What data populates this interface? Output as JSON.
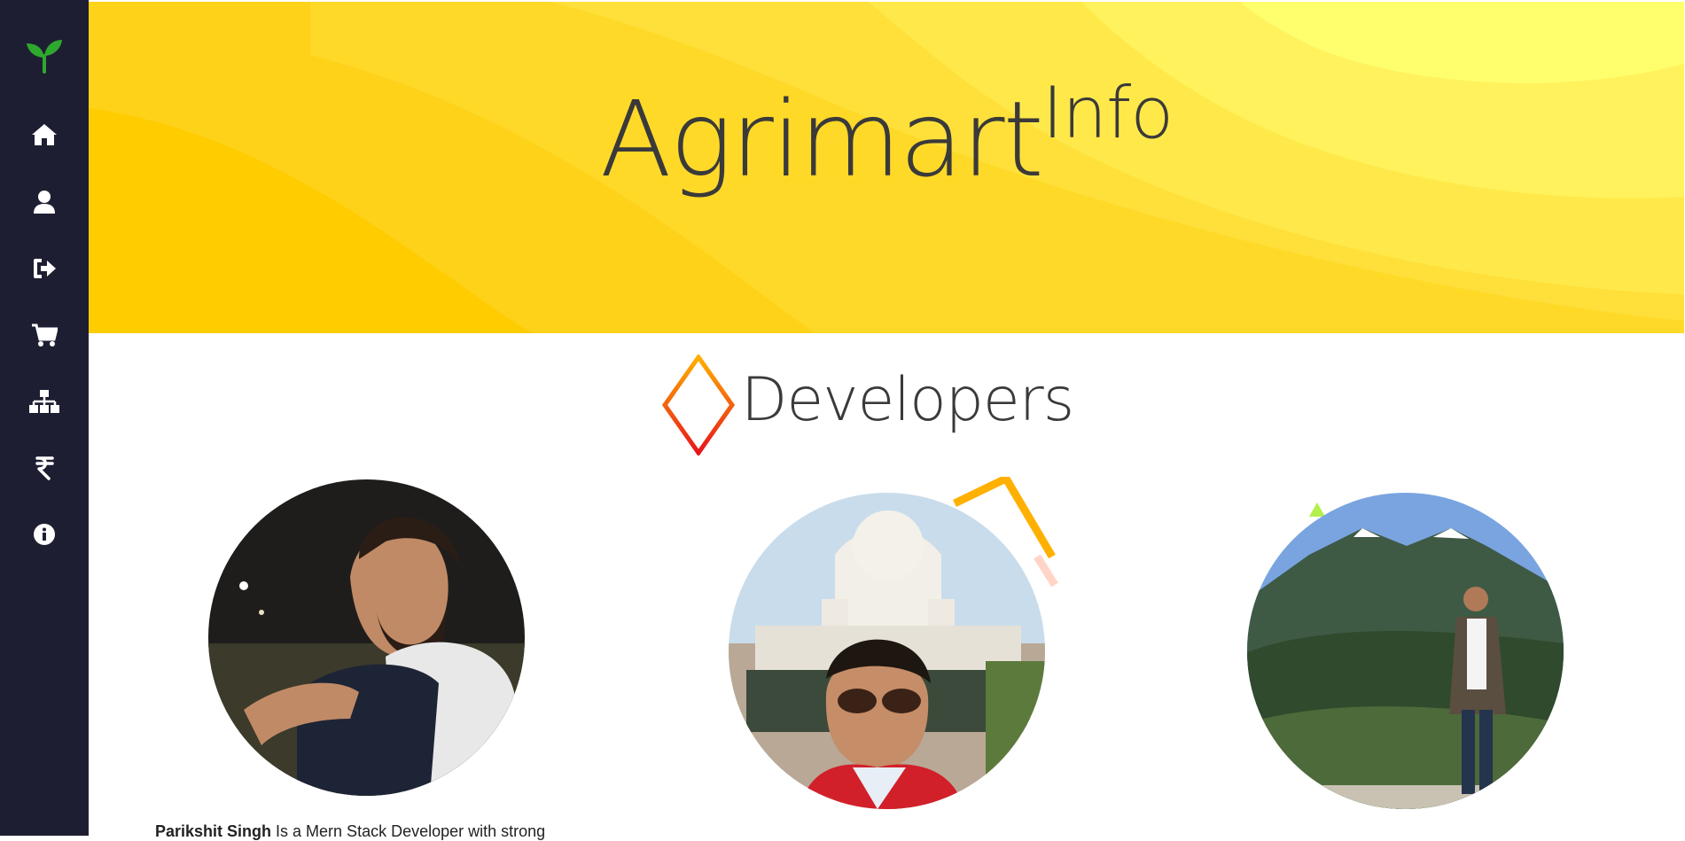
{
  "sidebar": {
    "items": [
      {
        "icon": "sprout-logo-icon"
      },
      {
        "icon": "home-icon"
      },
      {
        "icon": "user-icon"
      },
      {
        "icon": "sign-out-icon"
      },
      {
        "icon": "shopping-cart-icon"
      },
      {
        "icon": "sitemap-icon"
      },
      {
        "icon": "rupee-icon"
      },
      {
        "icon": "info-icon"
      }
    ]
  },
  "hero": {
    "title": "Agrimart",
    "superscript": "Info"
  },
  "developers": {
    "heading": "Developers",
    "members": [
      {
        "name": "Parikshit Singh",
        "bio_snippet": " Is a Mern Stack Developer with strong"
      },
      {
        "name": "",
        "bio_snippet": ""
      },
      {
        "name": "",
        "bio_snippet": ""
      }
    ]
  },
  "colors": {
    "sidebar_bg": "#1e1e33",
    "brand_green": "#2ea82e",
    "hero_yellow": "#ffd21a",
    "text_dark": "#3a3a3a",
    "diamond_gradient_top": "#ffb000",
    "diamond_gradient_bottom": "#e8141c"
  }
}
